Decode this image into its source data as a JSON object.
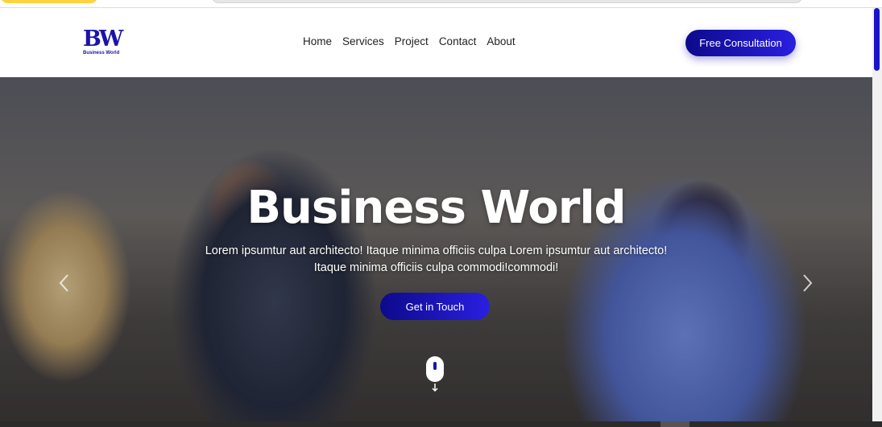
{
  "brand": {
    "logo_mark": "BW",
    "logo_sub": "Business World",
    "color": "#1a14a8"
  },
  "nav": {
    "links": [
      "Home",
      "Services",
      "Project",
      "Contact",
      "About"
    ],
    "cta_label": "Free Consultation"
  },
  "hero": {
    "title": "Business World",
    "line1": "Lorem ipsumtur aut architecto! Itaque minima officiis culpa Lorem ipsumtur aut architecto!",
    "line2": "Itaque minima officiis culpa commodi!commodi!",
    "button_label": "Get in Touch",
    "prev_icon": "chevron-left-icon",
    "next_icon": "chevron-right-icon",
    "scroll_icon": "mouse-scroll-icon"
  },
  "colors": {
    "accent": "#1a14c9",
    "button_gradient_start": "#0d0a8c",
    "button_gradient_end": "#2a1fe0"
  }
}
